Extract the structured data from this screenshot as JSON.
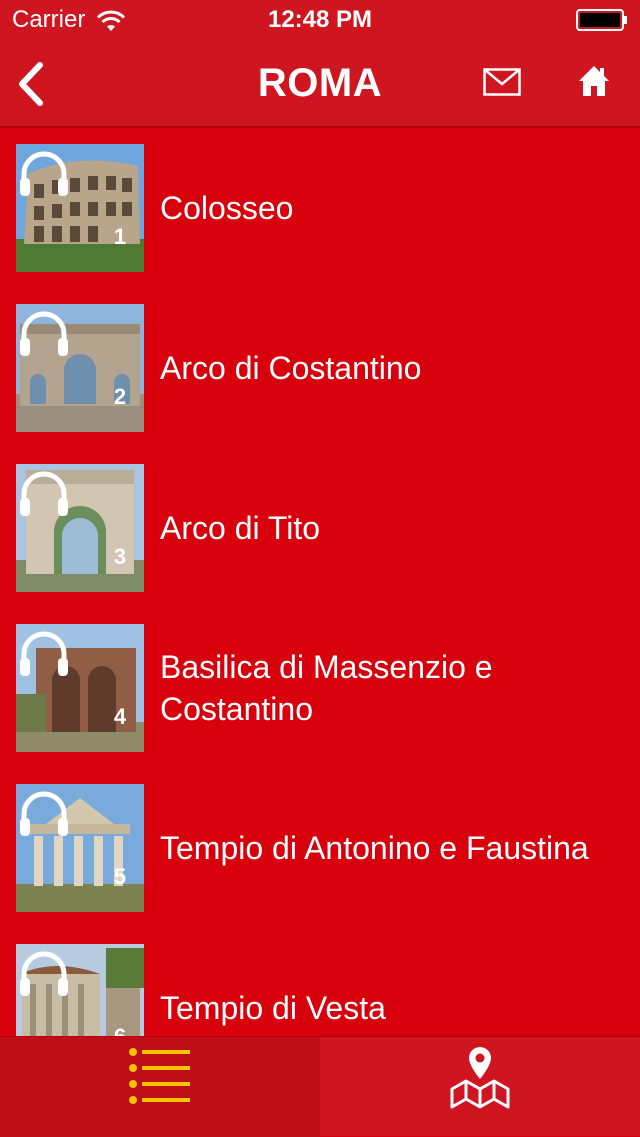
{
  "status_bar": {
    "carrier": "Carrier",
    "time": "12:48 PM"
  },
  "nav": {
    "title": "ROMA",
    "back_icon": "chevron-left-icon",
    "mail_icon": "envelope-icon",
    "home_icon": "home-icon"
  },
  "list": {
    "items": [
      {
        "label": "Colosseo",
        "number": "1"
      },
      {
        "label": "Arco di Costantino",
        "number": "2"
      },
      {
        "label": "Arco di Tito",
        "number": "3"
      },
      {
        "label": "Basilica di Massenzio e Costantino",
        "number": "4"
      },
      {
        "label": "Tempio di Antonino e Faustina",
        "number": "5"
      },
      {
        "label": "Tempio di Vesta",
        "number": "6"
      }
    ]
  },
  "tabbar": {
    "list_icon": "list-icon",
    "map_icon": "map-pin-icon",
    "active": "list"
  },
  "colors": {
    "background": "#d9000d",
    "bar": "#cf1520",
    "accent_yellow": "#f5c400"
  }
}
